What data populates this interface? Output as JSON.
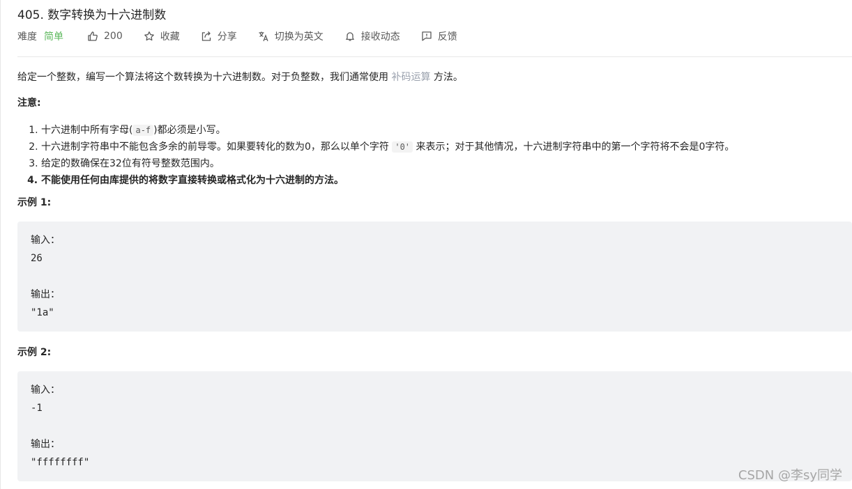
{
  "problem": {
    "title": "405. 数字转换为十六进制数"
  },
  "meta": {
    "difficulty_label": "难度",
    "difficulty_value": "简单",
    "likes": "200",
    "favorite_label": "收藏",
    "share_label": "分享",
    "switch_lang_label": "切换为英文",
    "subscribe_label": "接收动态",
    "feedback_label": "反馈"
  },
  "description": {
    "before_link": "给定一个整数，编写一个算法将这个数转换为十六进制数。对于负整数，我们通常使用 ",
    "link_text": "补码运算",
    "after_link": " 方法。"
  },
  "notice": {
    "title": "注意:",
    "items": [
      {
        "before": "十六进制中所有字母(",
        "code": "a-f",
        "after": ")都必须是小写。"
      },
      {
        "before": "十六进制字符串中不能包含多余的前导零。如果要转化的数为0，那么以单个字符 ",
        "code": "'0'",
        "after": " 来表示；对于其他情况，十六进制字符串中的第一个字符将不会是0字符。"
      },
      {
        "text": "给定的数确保在32位有符号整数范围内。"
      },
      {
        "text": "不能使用任何由库提供的将数字直接转换或格式化为十六进制的方法。"
      }
    ]
  },
  "examples": [
    {
      "title": "示例 1:",
      "input_label": "输入：",
      "input": "26",
      "output_label": "输出：",
      "output": "\"1a\""
    },
    {
      "title": "示例 2:",
      "input_label": "输入：",
      "input": "-1",
      "output_label": "输出：",
      "output": "\"ffffffff\""
    }
  ],
  "watermark": "CSDN @李sy同学",
  "colors": {
    "difficulty_easy": "#5cb85c",
    "link": "#9aa1ad",
    "code_background": "#f1f2f4"
  },
  "icons": [
    "thumbs-up-icon",
    "star-icon",
    "share-icon",
    "translate-icon",
    "bell-icon",
    "feedback-icon"
  ]
}
